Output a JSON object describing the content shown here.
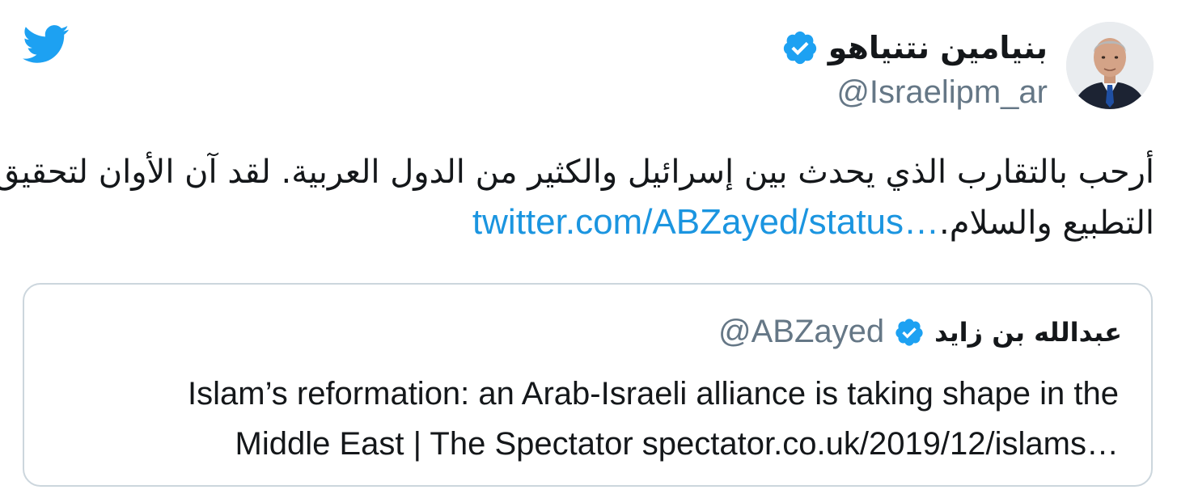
{
  "tweet": {
    "author_name": "بنيامين نتنياهو",
    "author_handle": "@Israelipm_ar",
    "text_line_1": "أرحب بالتقارب الذي يحدث بين إسرائيل والكثير من الدول العربية. لقد آن الأوان لتحقيق",
    "text_line_2": "التطبيع والسلام.",
    "link_text": "twitter.com/ABZayed/status…"
  },
  "quoted_tweet": {
    "author_name": "عبدالله بن زايد",
    "author_handle": "@ABZayed",
    "text_line_1": "Islam’s reformation: an Arab-Israeli alliance is taking shape in the",
    "text_line_2": "Middle East | The Spectator spectator.co.uk/2019/12/islams…"
  },
  "icons": {
    "brand": "twitter-bird-icon",
    "verified": "verified-badge-icon"
  },
  "colors": {
    "brand_blue": "#1da1f2",
    "link_blue": "#1b95e0",
    "handle_gray": "#657786",
    "border_gray": "#ccd6dd",
    "text_dark": "#14171a"
  }
}
